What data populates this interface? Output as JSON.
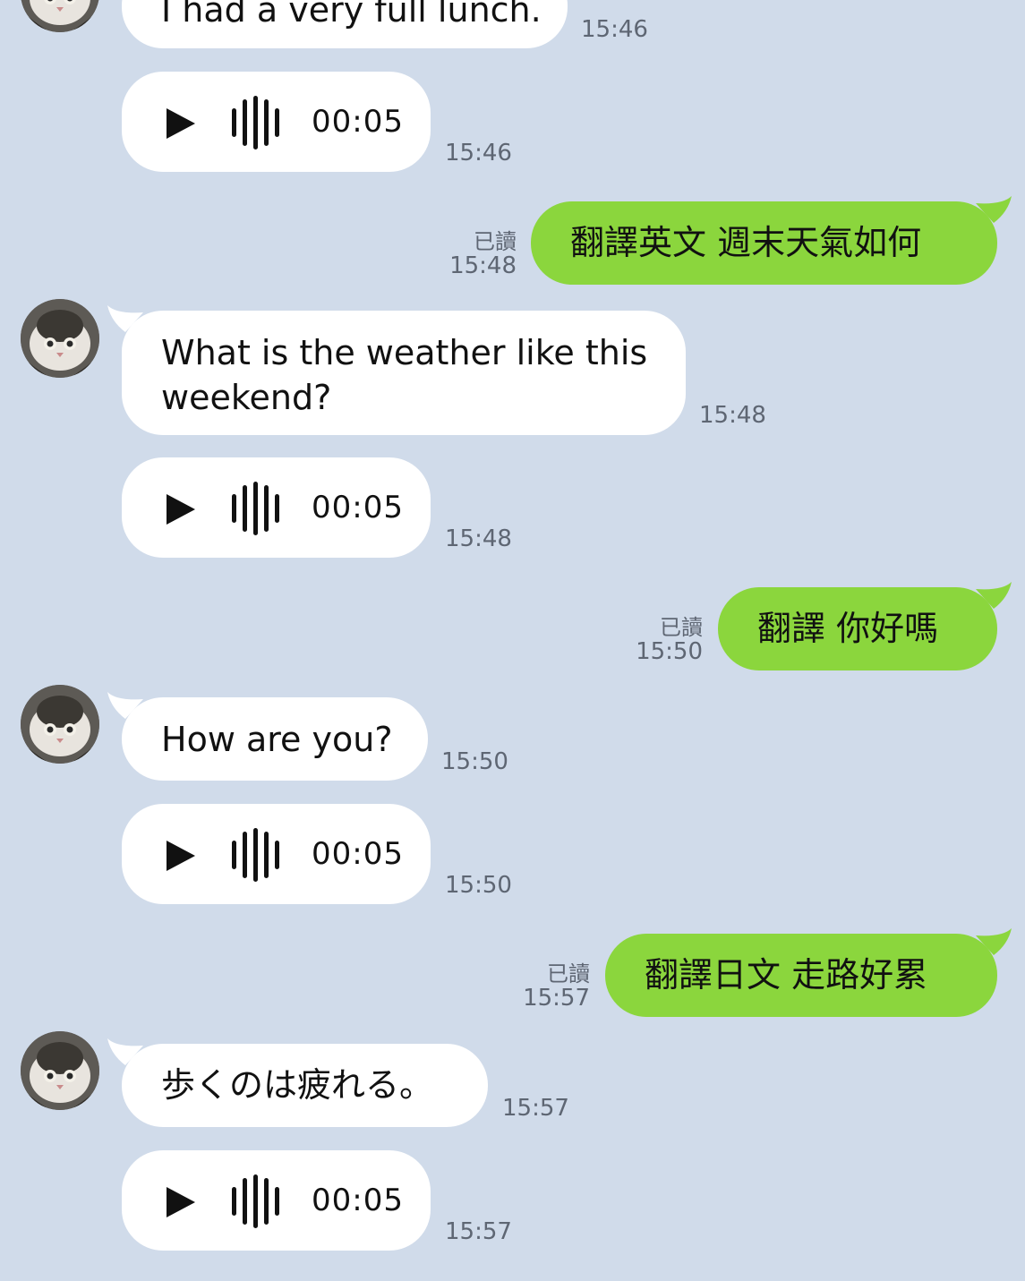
{
  "messages": [
    {
      "side": "in",
      "kind": "text",
      "text": "I had a very full lunch.",
      "time": "15:46"
    },
    {
      "side": "in",
      "kind": "voice",
      "duration": "00:05",
      "time": "15:46"
    },
    {
      "side": "out",
      "text": "翻譯英文 週末天氣如何",
      "read": "已讀",
      "time": "15:48"
    },
    {
      "side": "in",
      "kind": "text",
      "line1": "What is the weather like this",
      "line2": "weekend?",
      "time": "15:48"
    },
    {
      "side": "in",
      "kind": "voice",
      "duration": "00:05",
      "time": "15:48"
    },
    {
      "side": "out",
      "text": "翻譯 你好嗎",
      "read": "已讀",
      "time": "15:50"
    },
    {
      "side": "in",
      "kind": "text",
      "text": "How are you?",
      "time": "15:50"
    },
    {
      "side": "in",
      "kind": "voice",
      "duration": "00:05",
      "time": "15:50"
    },
    {
      "side": "out",
      "text": "翻譯日文 走路好累",
      "read": "已讀",
      "time": "15:57"
    },
    {
      "side": "in",
      "kind": "text",
      "text": "歩くのは疲れる。",
      "time": "15:57"
    },
    {
      "side": "in",
      "kind": "voice",
      "duration": "00:05",
      "time": "15:57"
    }
  ],
  "colors": {
    "background": "#d0dbea",
    "incoming_bubble": "#ffffff",
    "outgoing_bubble": "#8bd63d",
    "timestamp": "#5e6673"
  },
  "icons": {
    "play": "play-icon",
    "waveform": "waveform-icon",
    "avatar": "cat-avatar"
  }
}
